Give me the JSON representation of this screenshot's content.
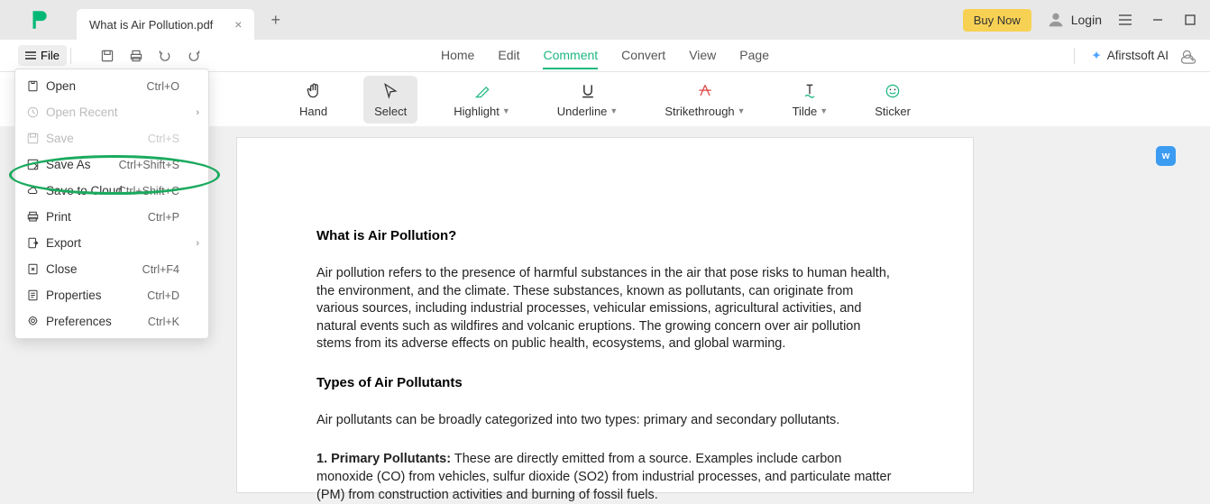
{
  "titlebar": {
    "tab_name": "What is Air Pollution.pdf",
    "buy_now": "Buy Now",
    "login": "Login"
  },
  "topbar": {
    "file_label": "File"
  },
  "nav": {
    "home": "Home",
    "edit": "Edit",
    "comment": "Comment",
    "convert": "Convert",
    "view": "View",
    "page": "Page",
    "ai": "Afirstsoft AI"
  },
  "tools": {
    "hand": "Hand",
    "select": "Select",
    "highlight": "Highlight",
    "underline": "Underline",
    "strikethrough": "Strikethrough",
    "tilde": "Tilde",
    "sticker": "Sticker"
  },
  "doc": {
    "h1": "What is Air Pollution?",
    "p1": "Air pollution refers to the presence of harmful substances in the air that pose risks to human health, the environment, and the climate. These substances, known as pollutants, can originate from various sources, including industrial processes, vehicular emissions, agricultural activities, and natural events such as wildfires and volcanic eruptions. The growing concern over air pollution stems from its adverse effects on public health, ecosystems, and global warming.",
    "h2": "Types of Air Pollutants",
    "p2": "Air pollutants can be broadly categorized into two types: primary and secondary pollutants.",
    "p3_bold": "1. Primary Pollutants:",
    "p3_rest": " These are directly emitted from a source. Examples include carbon monoxide (CO) from vehicles, sulfur dioxide (SO2) from industrial processes, and particulate matter (PM) from construction activities and burning of fossil fuels."
  },
  "menu": {
    "open": {
      "label": "Open",
      "shortcut": "Ctrl+O"
    },
    "open_recent": {
      "label": "Open Recent",
      "shortcut": ""
    },
    "save": {
      "label": "Save",
      "shortcut": "Ctrl+S"
    },
    "save_as": {
      "label": "Save As",
      "shortcut": "Ctrl+Shift+S"
    },
    "save_cloud": {
      "label": "Save to Cloud",
      "shortcut": "Ctrl+Shift+C"
    },
    "print": {
      "label": "Print",
      "shortcut": "Ctrl+P"
    },
    "export": {
      "label": "Export",
      "shortcut": ""
    },
    "close": {
      "label": "Close",
      "shortcut": "Ctrl+F4"
    },
    "properties": {
      "label": "Properties",
      "shortcut": "Ctrl+D"
    },
    "preferences": {
      "label": "Preferences",
      "shortcut": "Ctrl+K"
    }
  },
  "badge": {
    "w": "w"
  }
}
